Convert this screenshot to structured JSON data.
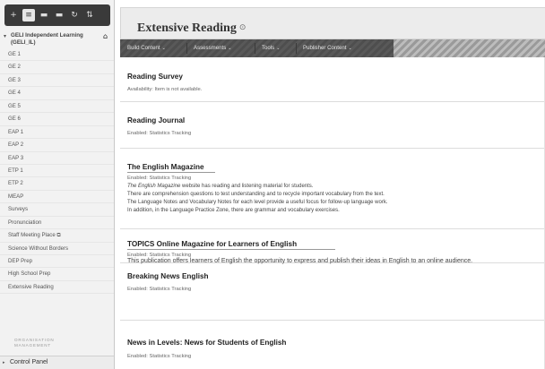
{
  "toolbar": {
    "icons": [
      "add-icon",
      "menu-icon",
      "folder-icon",
      "folder-icon",
      "refresh-icon",
      "sort-icon"
    ],
    "glyphs": [
      "+",
      "≡",
      "▬",
      "▬",
      "↻",
      "⇅"
    ]
  },
  "course": {
    "title": "GELI Independent Learning (GELI_IL)"
  },
  "sidebar": {
    "items": [
      {
        "label": "GE 1"
      },
      {
        "label": "GE 2"
      },
      {
        "label": "GE 3"
      },
      {
        "label": "GE 4"
      },
      {
        "label": "GE 5"
      },
      {
        "label": "GE 6"
      },
      {
        "label": "EAP 1"
      },
      {
        "label": "EAP 2"
      },
      {
        "label": "EAP 3"
      },
      {
        "label": "ETP 1"
      },
      {
        "label": "ETP 2"
      },
      {
        "label": "MEAP"
      },
      {
        "label": "Surveys"
      },
      {
        "label": "Pronunciation"
      },
      {
        "label": "Staff Meeting Place ⧉"
      },
      {
        "label": "Science Without Borders"
      },
      {
        "label": "DEP Prep"
      },
      {
        "label": "High School Prep"
      },
      {
        "label": "Extensive Reading"
      }
    ],
    "org_label_1": "ORGANISATION",
    "org_label_2": "MANAGEMENT",
    "control_panel": "Control Panel"
  },
  "page": {
    "title": "Extensive Reading",
    "title_chevron": "⊙"
  },
  "action_bar": {
    "build_content": "Build Content",
    "assessments": "Assessments",
    "tools": "Tools",
    "publisher_content": "Publisher Content",
    "caret": "⌄"
  },
  "items": [
    {
      "title": "Reading Survey",
      "meta": "Availability:  Item is not available."
    },
    {
      "title": "Reading Journal",
      "meta": "Enabled:  Statistics Tracking"
    },
    {
      "title": "The English Magazine",
      "meta": "Enabled:  Statistics Tracking",
      "line1_ital": "The English Magazine",
      "line1_rest": " website has reading and listening material for students.",
      "line2": "There are comprehension questions to test understanding and to recycle important vocabulary from the text.",
      "line3": "The Language Notes and Vocabulary Notes for each level provide a useful focus for follow-up language work.",
      "line4": "In addition, in the Language Practice Zone, there are grammar and vocabulary exercises."
    },
    {
      "title": "TOPICS Online Magazine for Learners of English",
      "meta": "Enabled:  Statistics Tracking",
      "line1": "This publication offers learners of English the opportunity to express and publish their ideas in English to an online audience."
    },
    {
      "title": "Breaking News English",
      "meta": "Enabled:  Statistics Tracking"
    },
    {
      "title": "News in Levels: News for Students of English",
      "meta": "Enabled:  Statistics Tracking"
    }
  ]
}
